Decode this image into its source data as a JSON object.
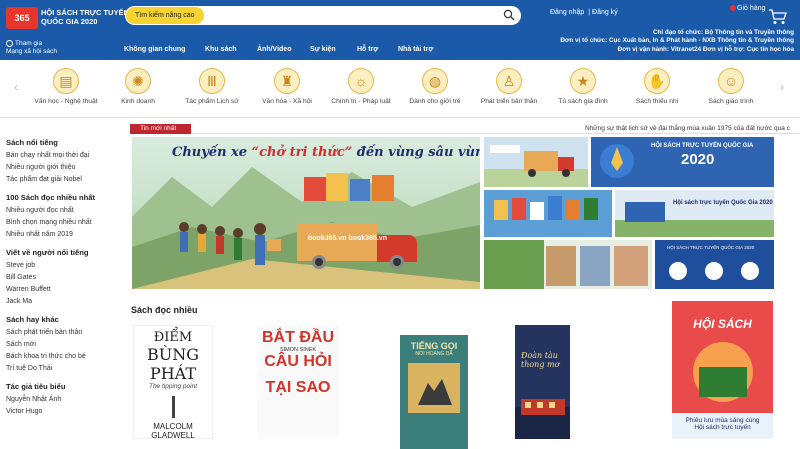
{
  "header": {
    "logo": "365",
    "site_title": "HỘI SÁCH TRỰC TUYẾN QUỐC GIA 2020",
    "search_button": "Tìm kiếm nâng cao",
    "search_placeholder": "",
    "login": "Đăng nhập",
    "register": "Đăng ký",
    "cart": "Giỏ hàng",
    "join_line1": "Tham gia",
    "join_line2": "Mạng xã hội sách",
    "org_lines": [
      "Chỉ đạo tổ chức: Bộ Thông tin và Truyền thông",
      "Đơn vị tổ chức: Cục Xuất bản, In & Phát hành - NXB Thông tin & Truyền thông",
      "Đơn vị vận hành: Vitranet24   Đơn vị hỗ trợ: Cục tin học hóa"
    ],
    "nav": [
      "Không gian chung",
      "Khu sách",
      "Ảnh/Video",
      "Sự kiện",
      "Hỗ trợ",
      "Nhà tài trợ"
    ]
  },
  "categories": [
    {
      "label": "Văn học - Nghệ thuật",
      "icon": "book-icon"
    },
    {
      "label": "Kinh doanh",
      "icon": "atom-icon"
    },
    {
      "label": "Tác phẩm Lịch sử",
      "icon": "pillar-icon"
    },
    {
      "label": "Văn hóa - Xã hội",
      "icon": "statue-icon"
    },
    {
      "label": "Chính trị - Pháp luật",
      "icon": "emblem-icon"
    },
    {
      "label": "Dành cho giới trẻ",
      "icon": "globe-icon"
    },
    {
      "label": "Phát triển bản thân",
      "icon": "person-icon"
    },
    {
      "label": "Tủ sách gia đình",
      "icon": "star-icon"
    },
    {
      "label": "Sách thiếu nhi",
      "icon": "hand-icon"
    },
    {
      "label": "Sách giáo trình",
      "icon": "mask-icon"
    }
  ],
  "sidebar": [
    {
      "heading": "Sách nổi tiếng",
      "items": [
        "Bán chạy nhất mọi thời đại",
        "Nhiều người giới thiệu",
        "Tác phẩm đạt giải Nobel"
      ]
    },
    {
      "heading": "100 Sách đọc nhiều nhất",
      "items": [
        "Nhiều người đọc nhất",
        "Bình chọn mạng nhiều nhất",
        "Nhiều nhất năm 2019"
      ]
    },
    {
      "heading": "Viết về người nổi tiếng",
      "items": [
        "Steve job",
        "Bill Gates",
        "Warren Buffett",
        "Jack Ma"
      ]
    },
    {
      "heading": "Sách hay khác",
      "items": [
        "Sách phát triển bản thân",
        "Sách mới",
        "Bách khoa tri thức cho bé",
        "Trí tuệ Do Thái"
      ]
    },
    {
      "heading": "Tác giả tiêu biểu",
      "items": [
        "Nguyễn Nhật Ánh",
        "Victor Hugo"
      ]
    }
  ],
  "ticker": {
    "tag": "Tin mới nhất",
    "text": "Những sự thật lịch sử về đại thắng mùa xuân 1975 của đất nước qua c"
  },
  "hero": {
    "title_pre": "Chuyến xe ",
    "title_quote": "“chở tri thức”",
    "title_post": " đến vùng sâu vùng xa",
    "truck_text": "book365.vn   book365.vn"
  },
  "thumbs": {
    "banner_title": "HỘI SÁCH TRỰC TUYẾN QUỐC GIA",
    "banner_year": "2020",
    "banner2": "Hội sách trực tuyến Quốc Gia 2020",
    "banner4_title": "HỘI SÁCH TRỰC TUYẾN QUỐC GIA 2020"
  },
  "section_title": "Sách đọc nhiều",
  "books": [
    {
      "title_l1": "ĐIỂM",
      "title_l2": "BÙNG",
      "title_l3": "PHÁT",
      "subtitle": "The tipping point",
      "author_l1": "MALCOLM",
      "author_l2": "GLADWELL"
    },
    {
      "title_l1": "BẮT ĐẦU",
      "title_l2": "CÂU HỎI",
      "title_l3": "TẠI SAO",
      "author": "SIMON SINEK"
    },
    {
      "title": "TIẾNG GỌI",
      "subtitle": "NƠI HOANG DÃ"
    },
    {
      "title": "Đoàn tàu thong mơ"
    },
    {
      "title": "HỘI SÁCH",
      "caption_l1": "Phiêu lưu mùa sáng cùng",
      "caption_l2": "Hội sách trực tuyến"
    }
  ],
  "colors": {
    "brand_blue": "#1a5aa8",
    "accent_yellow": "#f5d432",
    "red": "#c0262d"
  }
}
